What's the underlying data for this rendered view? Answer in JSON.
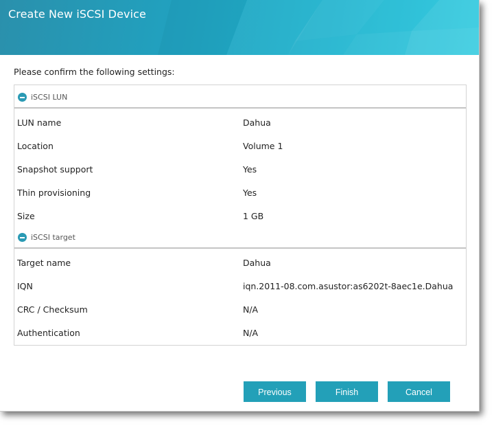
{
  "dialog": {
    "title": "Create New iSCSI Device",
    "prompt": "Please confirm the following settings:"
  },
  "sections": {
    "lun": {
      "label": "iSCSI LUN",
      "rows": [
        {
          "key": "LUN name",
          "value": "Dahua"
        },
        {
          "key": "Location",
          "value": "Volume 1"
        },
        {
          "key": "Snapshot support",
          "value": "Yes"
        },
        {
          "key": "Thin provisioning",
          "value": "Yes"
        },
        {
          "key": "Size",
          "value": "1 GB"
        }
      ]
    },
    "target": {
      "label": "iSCSI target",
      "rows": [
        {
          "key": "Target name",
          "value": "Dahua"
        },
        {
          "key": "IQN",
          "value": "iqn.2011-08.com.asustor:as6202t-8aec1e.Dahua"
        },
        {
          "key": "CRC / Checksum",
          "value": "N/A"
        },
        {
          "key": "Authentication",
          "value": "N/A"
        }
      ]
    }
  },
  "buttons": {
    "previous": "Previous",
    "finish": "Finish",
    "cancel": "Cancel"
  },
  "colors": {
    "accent": "#23a0b8",
    "title_bar": "#20a3c1"
  },
  "icons": {
    "section_toggle": "collapse-minus-icon"
  }
}
